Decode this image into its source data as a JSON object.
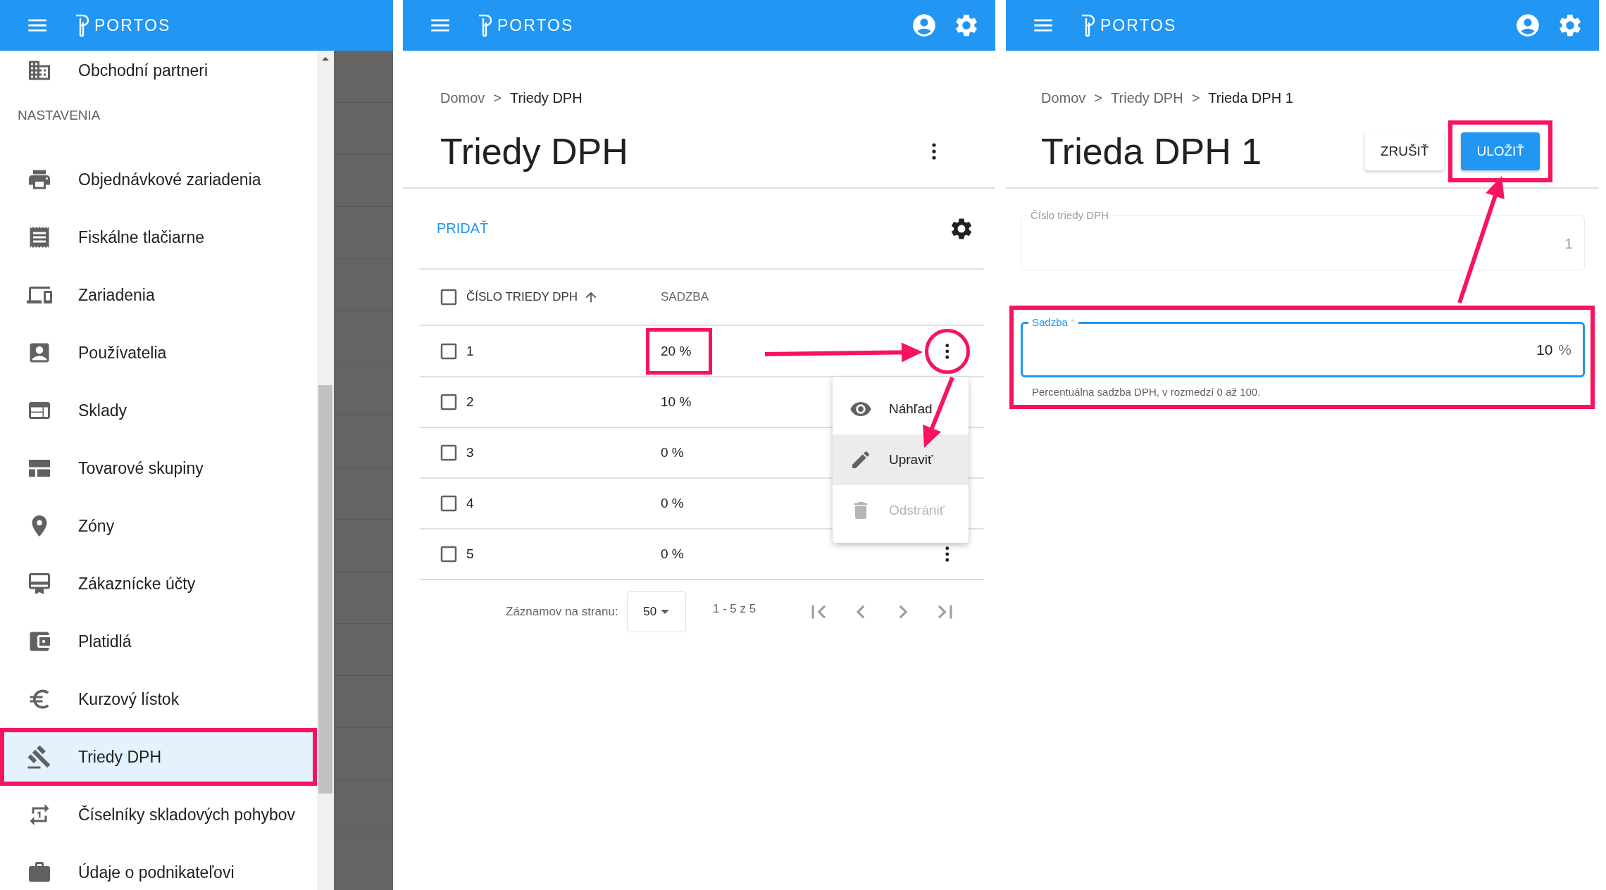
{
  "sidebar_screen": {
    "header": {
      "app_name": "PORTOS"
    },
    "items_top": [
      {
        "label": "Obchodní partneri",
        "selected": false,
        "highlighted": false
      }
    ],
    "section_title": "NASTAVENIA",
    "items": [
      {
        "label": "Objednávkové zariadenia",
        "selected": false,
        "highlighted": false
      },
      {
        "label": "Fiskálne tlačiarne",
        "selected": false,
        "highlighted": false
      },
      {
        "label": "Zariadenia",
        "selected": false,
        "highlighted": false
      },
      {
        "label": "Používatelia",
        "selected": false,
        "highlighted": false
      },
      {
        "label": "Sklady",
        "selected": false,
        "highlighted": false
      },
      {
        "label": "Tovarové skupiny",
        "selected": false,
        "highlighted": false
      },
      {
        "label": "Zóny",
        "selected": false,
        "highlighted": false
      },
      {
        "label": "Zákaznícke účty",
        "selected": false,
        "highlighted": false
      },
      {
        "label": "Platidlá",
        "selected": false,
        "highlighted": false
      },
      {
        "label": "Kurzový lístok",
        "selected": false,
        "highlighted": false
      },
      {
        "label": "Triedy DPH",
        "selected": true,
        "highlighted": true
      },
      {
        "label": "Číselníky skladových pohybov",
        "selected": false,
        "highlighted": false
      },
      {
        "label": "Údaje o podnikateľovi",
        "selected": false,
        "highlighted": false
      }
    ]
  },
  "list_screen": {
    "header": {
      "app_name": "PORTOS",
      "action_icons": [
        {
          "kind": "account"
        },
        {
          "kind": "settings"
        }
      ]
    },
    "breadcrumb": [
      {
        "kind": "link",
        "label": "Domov"
      },
      {
        "kind": "separator",
        "label": ">"
      },
      {
        "kind": "current",
        "label": "Triedy DPH"
      }
    ],
    "title": "Triedy DPH",
    "add_button": "PRIDAŤ",
    "select_all_checked": false,
    "columns": [
      {
        "label": "ČÍSLO TRIEDY DPH",
        "sorted": true
      },
      {
        "label": "SADZBA",
        "sorted": false
      }
    ],
    "rows": [
      {
        "number": "1",
        "rate": "20 %",
        "checked": false,
        "rate_highlighted": true,
        "actions_visible": true,
        "actions_highlighted": true
      },
      {
        "number": "2",
        "rate": "10 %",
        "checked": false,
        "rate_highlighted": false,
        "actions_visible": false
      },
      {
        "number": "3",
        "rate": "0 %",
        "checked": false,
        "rate_highlighted": false,
        "actions_visible": false
      },
      {
        "number": "4",
        "rate": "0 %",
        "checked": false,
        "rate_highlighted": false,
        "actions_visible": false
      },
      {
        "number": "5",
        "rate": "0 %",
        "checked": false,
        "rate_highlighted": false,
        "actions_visible": true,
        "actions_highlighted": false
      }
    ],
    "row_menu": [
      {
        "label": "Náhľad",
        "kind": "view",
        "hovered": false,
        "disabled": false
      },
      {
        "label": "Upraviť",
        "kind": "edit",
        "hovered": true,
        "disabled": false
      },
      {
        "label": "Odstrániť",
        "kind": "delete",
        "hovered": false,
        "disabled": true
      }
    ],
    "pagination": {
      "rows_per_page_label": "Záznamov na stranu:",
      "rows_per_page": "50",
      "range": "1 - 5 z 5"
    }
  },
  "detail_screen": {
    "header": {
      "app_name": "PORTOS",
      "action_icons": [
        {
          "kind": "account"
        },
        {
          "kind": "settings"
        }
      ]
    },
    "breadcrumb": [
      {
        "kind": "link",
        "label": "Domov"
      },
      {
        "kind": "separator",
        "label": ">"
      },
      {
        "kind": "link",
        "label": "Triedy DPH"
      },
      {
        "kind": "separator",
        "label": ">"
      },
      {
        "kind": "current",
        "label": "Trieda DPH 1"
      }
    ],
    "title": "Trieda DPH 1",
    "buttons": [
      {
        "label": "ZRUŠIŤ",
        "kind": "secondary",
        "highlighted": false
      },
      {
        "label": "ULOŽIŤ",
        "kind": "primary",
        "highlighted": true
      }
    ],
    "fields": [
      {
        "label": "Číslo triedy DPH",
        "value": "1",
        "disabled": true,
        "focused": false,
        "highlighted": false
      },
      {
        "label": "Sadzba",
        "required_mark": "*",
        "value": "10",
        "suffix": "%",
        "disabled": false,
        "focused": true,
        "helper": "Percentuálna sadzba DPH, v rozmedzí 0 až 100.",
        "highlighted": true
      }
    ]
  }
}
